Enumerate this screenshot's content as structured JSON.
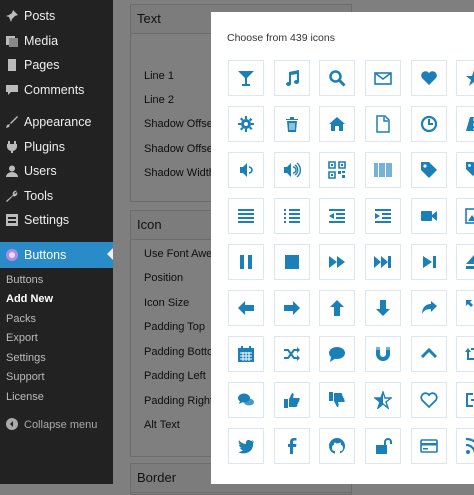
{
  "sidebar": {
    "items": [
      {
        "label": "Posts",
        "icon": "pin-icon"
      },
      {
        "label": "Media",
        "icon": "media-icon"
      },
      {
        "label": "Pages",
        "icon": "pages-icon"
      },
      {
        "label": "Comments",
        "icon": "comments-icon"
      },
      {
        "label": "Appearance",
        "icon": "brush-icon"
      },
      {
        "label": "Plugins",
        "icon": "plug-icon"
      },
      {
        "label": "Users",
        "icon": "user-icon"
      },
      {
        "label": "Tools",
        "icon": "wrench-icon"
      },
      {
        "label": "Settings",
        "icon": "settings-icon"
      },
      {
        "label": "Buttons",
        "icon": "buttons-plugin-icon"
      }
    ],
    "submenu": [
      "Buttons",
      "Add New",
      "Packs",
      "Export",
      "Settings",
      "Support",
      "License"
    ],
    "collapse_label": "Collapse menu",
    "active_color": "#2a8bc9"
  },
  "panels": {
    "text": {
      "title": "Text",
      "fields": [
        "Line 1",
        "Line 2",
        "Shadow Offset",
        "Shadow Offset",
        "Shadow Width"
      ]
    },
    "icon": {
      "title": "Icon",
      "fields": [
        "Use Font Awesome",
        "Position",
        "Icon Size",
        "Padding Top",
        "Padding Bottom",
        "Padding Left",
        "Padding Right",
        "Alt Text"
      ]
    },
    "border": {
      "title": "Border"
    }
  },
  "modal": {
    "title": "Choose from 439 icons",
    "icon_color": "#1b7fb8",
    "icons": [
      [
        "glass-icon",
        "music-icon",
        "search-icon",
        "envelope-icon",
        "heart-icon",
        "star-icon"
      ],
      [
        "cog-icon",
        "trash-icon",
        "home-icon",
        "file-icon",
        "clock-icon",
        "road-icon"
      ],
      [
        "volume-down-icon",
        "volume-up-icon",
        "qrcode-icon",
        "barcode-icon",
        "tag-icon",
        "tags-icon"
      ],
      [
        "align-justify-icon",
        "list-icon",
        "outdent-icon",
        "indent-icon",
        "video-camera-icon",
        "picture-icon"
      ],
      [
        "pause-icon",
        "stop-icon",
        "forward-icon",
        "fast-forward-icon",
        "step-forward-icon",
        "eject-icon"
      ],
      [
        "arrow-left-icon",
        "arrow-right-icon",
        "arrow-up-icon",
        "arrow-down-icon",
        "share-icon",
        "expand-icon"
      ],
      [
        "calendar-icon",
        "random-icon",
        "comment-icon",
        "magnet-icon",
        "chevron-up-icon",
        "retweet-icon"
      ],
      [
        "comments-icon",
        "thumbs-up-icon",
        "thumbs-down-icon",
        "star-half-icon",
        "heart-empty-icon",
        "sign-out-icon"
      ],
      [
        "twitter-icon",
        "facebook-icon",
        "github-icon",
        "unlock-icon",
        "credit-card-icon",
        "rss-icon"
      ]
    ]
  }
}
